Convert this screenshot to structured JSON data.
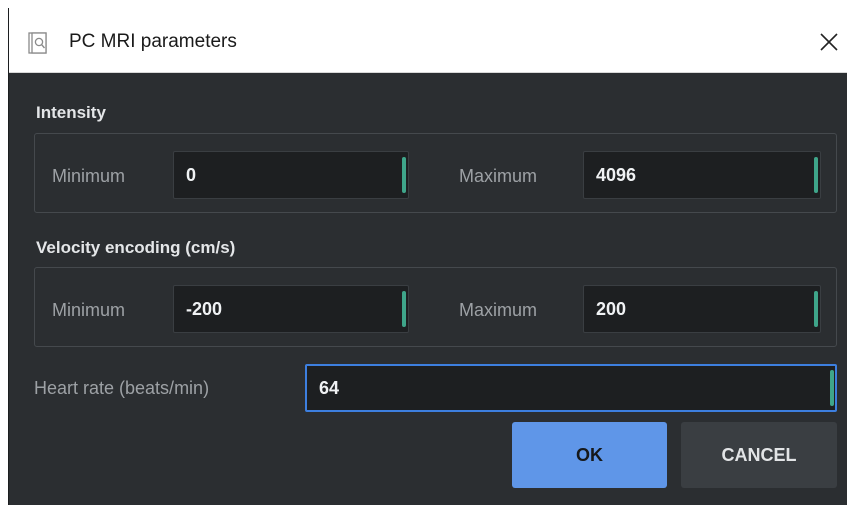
{
  "window": {
    "title": "PC MRI parameters",
    "icon": "search-document-icon",
    "close_icon": "close-icon"
  },
  "intensity": {
    "section_label": "Intensity",
    "min_label": "Minimum",
    "min_value": "0",
    "max_label": "Maximum",
    "max_value": "4096"
  },
  "velocity": {
    "section_label": "Velocity encoding (cm/s)",
    "min_label": "Minimum",
    "min_value": "-200",
    "max_label": "Maximum",
    "max_value": "200"
  },
  "heart_rate": {
    "label": "Heart rate (beats/min)",
    "value": "64"
  },
  "buttons": {
    "ok_label": "OK",
    "cancel_label": "CANCEL"
  },
  "colors": {
    "background": "#2b2e31",
    "accent_green": "#3fa58a",
    "ok_blue": "#5f96e8",
    "focus_blue": "#3d7fdf"
  }
}
